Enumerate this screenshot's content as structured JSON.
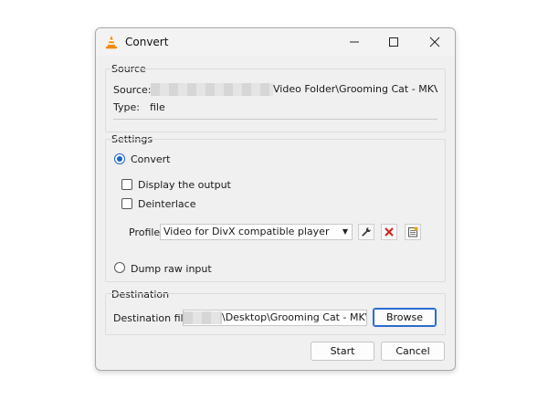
{
  "window": {
    "title": "Convert"
  },
  "source": {
    "group_label": "Source",
    "source_label": "Source:",
    "source_value": "Video Folder\\Grooming Cat - MKV.mkv",
    "type_label": "Type:",
    "type_value": "file"
  },
  "settings": {
    "group_label": "Settings",
    "convert_label": "Convert",
    "convert_selected": true,
    "display_output_label": "Display the output",
    "deinterlace_label": "Deinterlace",
    "profile_label": "Profile",
    "profile_value": "Video for DivX compatible player",
    "dump_raw_label": "Dump raw input"
  },
  "destination": {
    "group_label": "Destination",
    "file_label": "Destination file:",
    "file_value": "\\Desktop\\Grooming Cat - MKV.mkv",
    "browse_label": "Browse"
  },
  "footer": {
    "start_label": "Start",
    "cancel_label": "Cancel"
  },
  "colors": {
    "accent": "#1a63c8",
    "delete_red": "#d32020",
    "vlc_orange": "#f08a00"
  },
  "icons": [
    "vlc-cone-icon",
    "minimize-icon",
    "maximize-icon",
    "close-icon",
    "wrench-icon",
    "delete-icon",
    "new-profile-icon"
  ]
}
